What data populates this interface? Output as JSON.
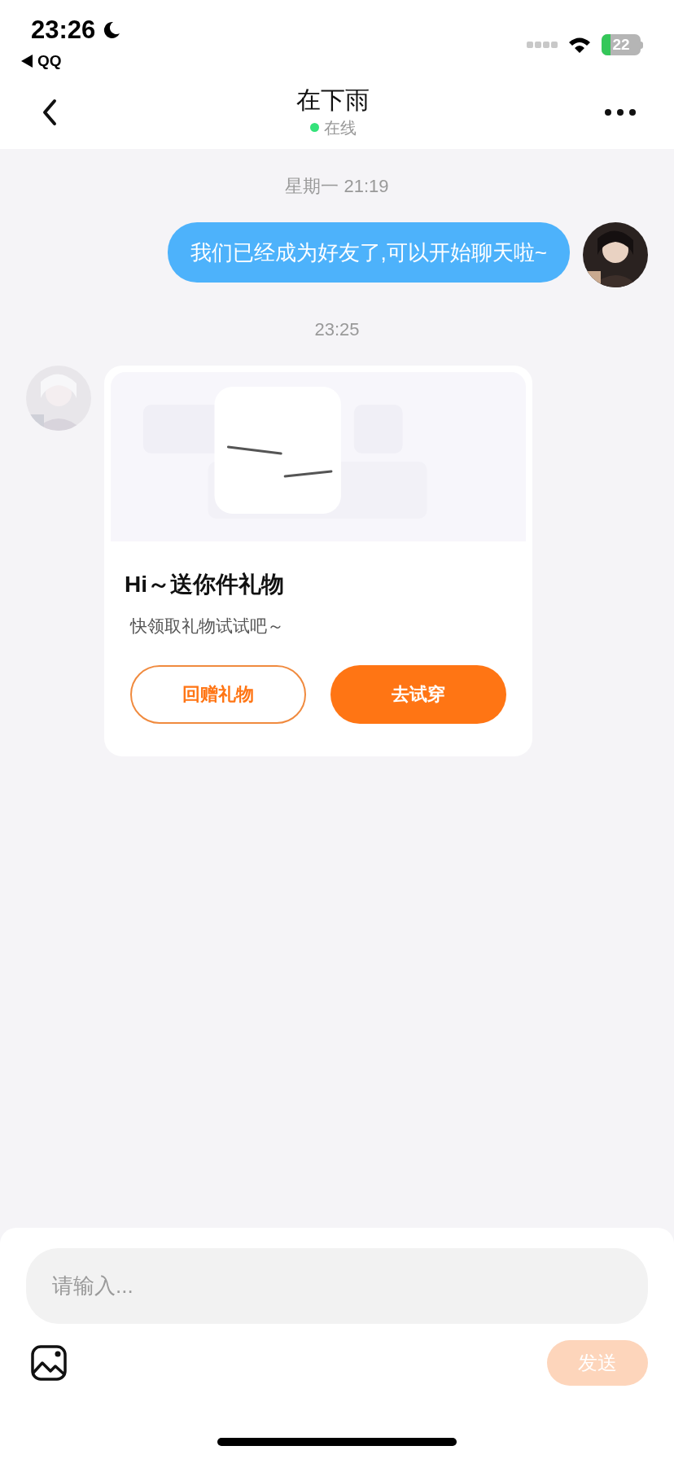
{
  "status_bar": {
    "time": "23:26",
    "back_app": "QQ",
    "battery": "22"
  },
  "header": {
    "title": "在下雨",
    "presence": "在线",
    "online": true
  },
  "messages": [
    {
      "kind": "timestamp",
      "text": "星期一 21:19"
    },
    {
      "kind": "outgoing",
      "text": "我们已经成为好友了,可以开始聊天啦~"
    },
    {
      "kind": "timestamp",
      "text": "23:25"
    },
    {
      "kind": "gift_card",
      "title": "Hi～送你件礼物",
      "subtitle": "快领取礼物试试吧～",
      "buttons": [
        {
          "label": "回赠礼物",
          "kind": "outline"
        },
        {
          "label": "去试穿",
          "kind": "filled"
        }
      ]
    }
  ],
  "composer": {
    "placeholder": "请输入...",
    "send": {
      "label": "发送",
      "disabled": true
    }
  }
}
